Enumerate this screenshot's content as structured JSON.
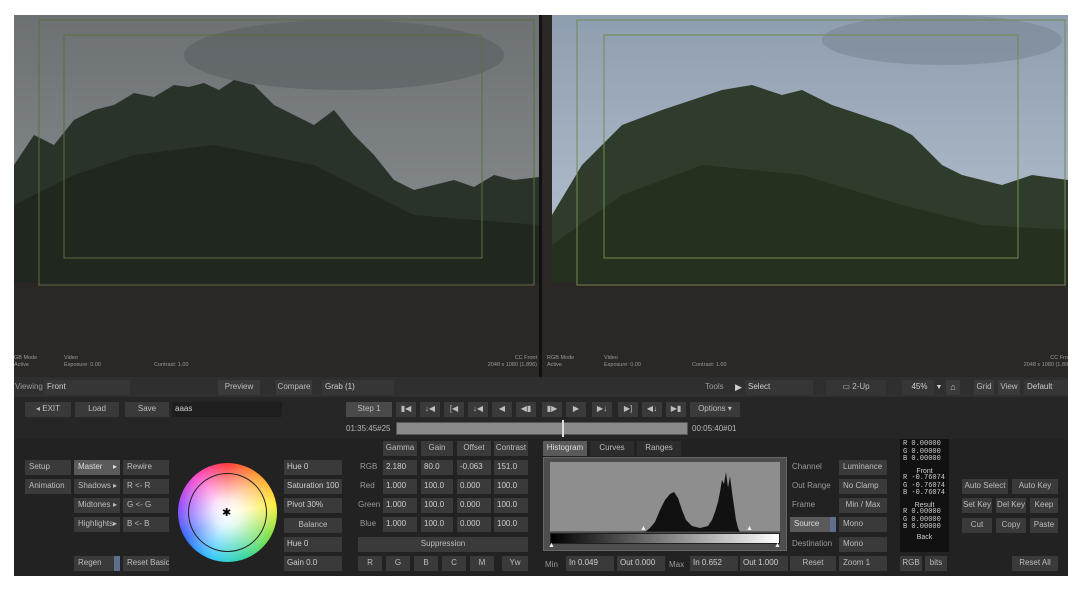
{
  "viewers": {
    "left": {
      "mode": "GB Mode",
      "mode_val": "Active",
      "type": "Video",
      "exposure": "Exposure: 0.00",
      "contrast": "Contrast: 1.00",
      "cc": "CC Front",
      "res": "2048 x 1080 (1.896)"
    },
    "right": {
      "mode": "RGB Mode",
      "mode_val": "Active",
      "type": "Video",
      "exposure": "Exposure: 0.00",
      "contrast": "Contrast: 1.00",
      "cc": "CC Fro",
      "res": "2048 x 1080 (1.89"
    }
  },
  "viewbar": {
    "viewing": "Viewing",
    "viewing_val": "Front",
    "preview": "Preview",
    "compare": "Compare",
    "grab": "Grab (1)",
    "tools": "Tools",
    "select": "Select",
    "two_up": "2-Up",
    "zoom": "45%",
    "grid": "Grid",
    "view": "View",
    "default": "Default"
  },
  "filebar": {
    "exit": "EXIT",
    "load": "Load",
    "save": "Save",
    "name": "aaas"
  },
  "transport": {
    "step": "Step 1",
    "options": "Options",
    "tc_start": "01:35:45#25",
    "tc_end": "00:05:40#01"
  },
  "color": {
    "setup": "Setup",
    "animation": "Animation",
    "master": "Master",
    "shadows": "Shadows",
    "midtones": "Midtones",
    "highlights": "Highlights",
    "rewire": "Rewire",
    "rr": "R <- R",
    "gg": "G <- G",
    "bb": "B <- B",
    "regen": "Regen",
    "reset_basics": "Reset Basics",
    "hue1": "Hue  0",
    "saturation": "Saturation 100",
    "pivot": "Pivot 30%",
    "balance": "Balance",
    "hue2": "Hue  0",
    "gain": "Gain 0.0"
  },
  "grading": {
    "headers": [
      "Gamma",
      "Gain",
      "Offset",
      "Contrast"
    ],
    "rows": [
      {
        "label": "RGB",
        "values": [
          "2.180",
          "80.0",
          "-0.063",
          "151.0"
        ]
      },
      {
        "label": "Red",
        "values": [
          "1.000",
          "100.0",
          "0.000",
          "100.0"
        ]
      },
      {
        "label": "Green",
        "values": [
          "1.000",
          "100.0",
          "0.000",
          "100.0"
        ]
      },
      {
        "label": "Blue",
        "values": [
          "1.000",
          "100.0",
          "0.000",
          "100.0"
        ]
      }
    ],
    "suppression": "Suppression",
    "supp_buttons": [
      "R",
      "G",
      "B",
      "C",
      "M",
      "Yw"
    ]
  },
  "histogram": {
    "tabs": [
      "Histogram",
      "Curves",
      "Ranges"
    ],
    "min": "Min",
    "in_min": "In 0.049",
    "out_min": "Out 0.000",
    "max": "Max",
    "in_max": "In 0.652",
    "out_max": "Out 1.000"
  },
  "channel": {
    "channel": "Channel",
    "luminance": "Luminance",
    "out_range": "Out Range",
    "no_clamp": "No Clamp",
    "frame": "Frame",
    "min_max": "Min / Max",
    "source": "Source",
    "mono1": "Mono",
    "destination": "Destination",
    "mono2": "Mono",
    "reset": "Reset",
    "zoom": "Zoom 1"
  },
  "readout": {
    "top": [
      "R  0.00000",
      "G  0.00000",
      "B  0.00000"
    ],
    "front_label": "Front",
    "front": [
      "R -0.76074",
      "G -0.76074",
      "B -0.76074"
    ],
    "result_label": "Result",
    "result": [
      "R  0.00000",
      "G  0.00000",
      "B  0.00000"
    ],
    "back": "Back",
    "rgb": "RGB",
    "bits": "bits"
  },
  "keys": {
    "auto_select": "Auto Select",
    "auto_key": "Auto Key",
    "set_key": "Set Key",
    "del_key": "Del Key",
    "keep": "Keep",
    "cut": "Cut",
    "copy": "Copy",
    "paste": "Paste",
    "reset_all": "Reset All"
  }
}
